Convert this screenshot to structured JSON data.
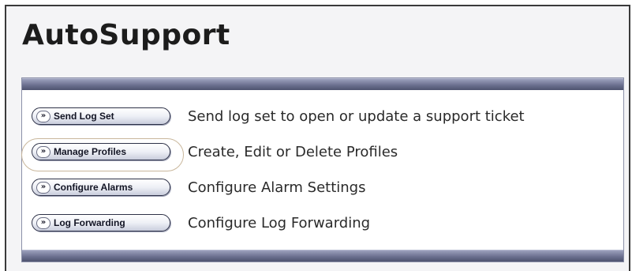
{
  "page": {
    "title": "AutoSupport"
  },
  "actions": [
    {
      "button_label": "Send Log Set",
      "description": "Send log set to open or update a support ticket"
    },
    {
      "button_label": "Manage Profiles",
      "description": "Create, Edit or Delete Profiles",
      "highlighted": true
    },
    {
      "button_label": "Configure Alarms",
      "description": "Configure Alarm Settings"
    },
    {
      "button_label": "Log Forwarding",
      "description": "Configure Log Forwarding"
    }
  ],
  "icons": {
    "button_glyph": "»",
    "button_icon_name": "double-chevron-right-icon"
  },
  "colors": {
    "panel_bar": "#6c7190",
    "button_border": "#2e3248",
    "highlight_ring": "#c9b79c"
  }
}
